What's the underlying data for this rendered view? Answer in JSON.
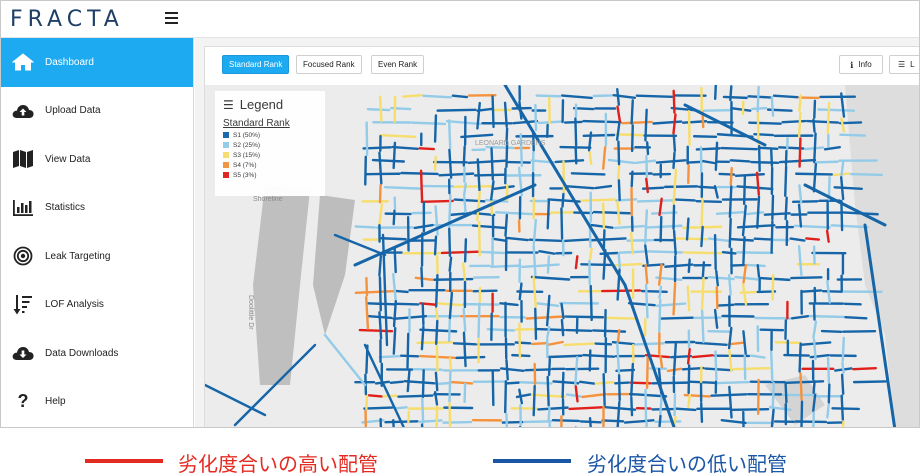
{
  "app": {
    "brand": "FRACTA"
  },
  "sidebar": {
    "items": [
      {
        "label": "Dashboard",
        "icon": "home-icon",
        "active": true
      },
      {
        "label": "Upload Data",
        "icon": "cloud-upload-icon",
        "active": false
      },
      {
        "label": "View Data",
        "icon": "map-icon",
        "active": false
      },
      {
        "label": "Statistics",
        "icon": "bar-chart-icon",
        "active": false
      },
      {
        "label": "Leak Targeting",
        "icon": "target-icon",
        "active": false
      },
      {
        "label": "LOF Analysis",
        "icon": "sort-amount-down-icon",
        "active": false
      },
      {
        "label": "Data Downloads",
        "icon": "cloud-download-icon",
        "active": false
      },
      {
        "label": "Help",
        "icon": "question-icon",
        "active": false
      }
    ]
  },
  "toolbar": {
    "ranks": [
      {
        "label": "Standard Rank",
        "active": true
      },
      {
        "label": "Focused Rank",
        "active": false
      },
      {
        "label": "Even Rank",
        "active": false
      }
    ],
    "info_label": "Info",
    "list_label": "L"
  },
  "legend": {
    "title": "Legend",
    "subtitle": "Standard Rank",
    "items": [
      {
        "label": "S1 (50%)",
        "color": "#1565a8"
      },
      {
        "label": "S2 (25%)",
        "color": "#93cbe8"
      },
      {
        "label": "S3 (15%)",
        "color": "#f6dd6c"
      },
      {
        "label": "S4 (7%)",
        "color": "#f5923e"
      },
      {
        "label": "S5 (3%)",
        "color": "#e0201b"
      }
    ]
  },
  "map": {
    "labels": [
      {
        "text": "Shoreline"
      },
      {
        "text": "Doolittle Dr"
      },
      {
        "text": "LEONARD GARDENS"
      }
    ]
  },
  "caption": {
    "high": {
      "text": "劣化度合いの高い配管",
      "color": "#e32b22"
    },
    "low": {
      "text": "劣化度合いの低い配管",
      "color": "#1a56a6"
    }
  }
}
